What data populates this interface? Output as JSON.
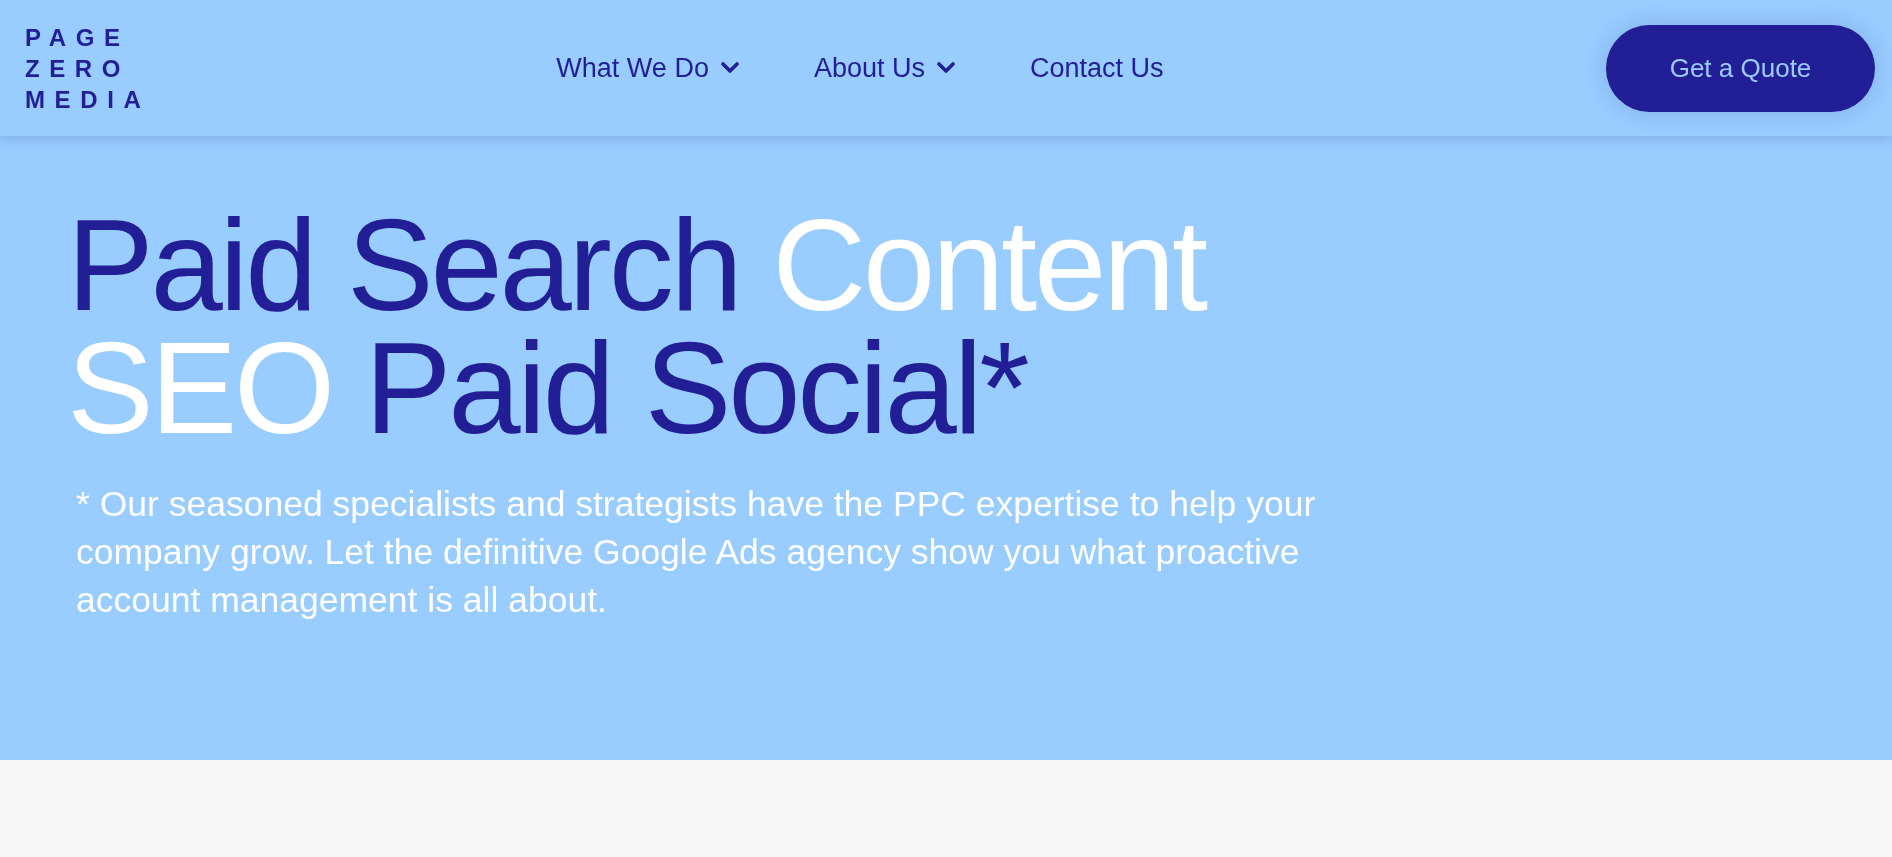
{
  "logo": {
    "lines": [
      "PAGE",
      "ZERO",
      "MEDIA"
    ]
  },
  "nav": [
    {
      "label": "What We Do",
      "kind": "dropdown"
    },
    {
      "label": "About Us",
      "kind": "dropdown"
    },
    {
      "label": "Contact Us",
      "kind": "link"
    }
  ],
  "cta_button": {
    "label": "Get a Quote"
  },
  "hero": {
    "headline": [
      {
        "text": "Paid Search",
        "highlighted": false
      },
      {
        "text": "Content",
        "highlighted": true
      },
      {
        "text": "SEO",
        "highlighted": true
      },
      {
        "text": "Paid Social*",
        "highlighted": false
      }
    ],
    "description": "* Our seasoned specialists and strategists have the PPC expertise to help your company grow. Let the definitive Google Ads agency show you what proactive account management is all about."
  }
}
